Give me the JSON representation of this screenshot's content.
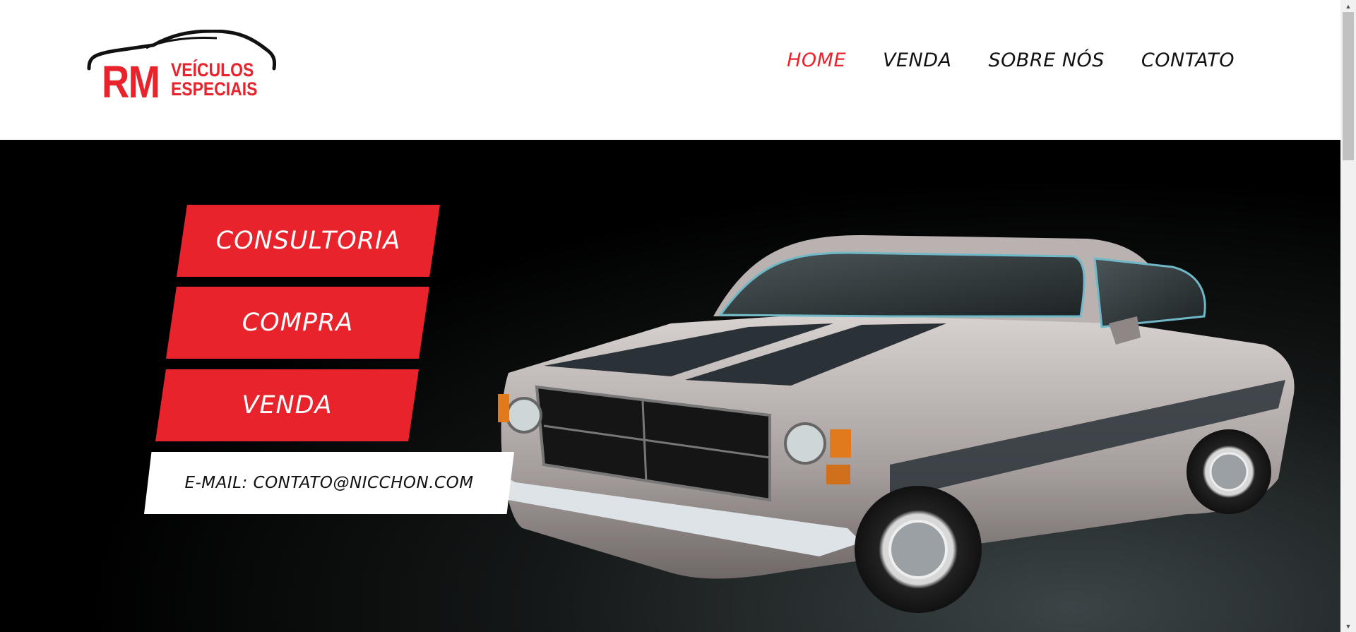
{
  "logo": {
    "initials": "RM",
    "line1": "VEÍCULOS",
    "line2": "ESPECIAIS"
  },
  "nav": [
    {
      "label": "HOME",
      "active": true
    },
    {
      "label": "VENDA",
      "active": false
    },
    {
      "label": "SOBRE NÓS",
      "active": false
    },
    {
      "label": "CONTATO",
      "active": false
    }
  ],
  "hero": {
    "buttons": [
      "CONSULTORIA",
      "COMPRA",
      "VENDA"
    ],
    "email": "E-MAIL: CONTATO@NICCHON.COM"
  },
  "colors": {
    "accent": "#e8232c",
    "hero_bg": "#000000",
    "header_bg": "#ffffff"
  },
  "icons": {
    "car_image": "classic-car-image",
    "logo_car": "car-outline-icon"
  }
}
